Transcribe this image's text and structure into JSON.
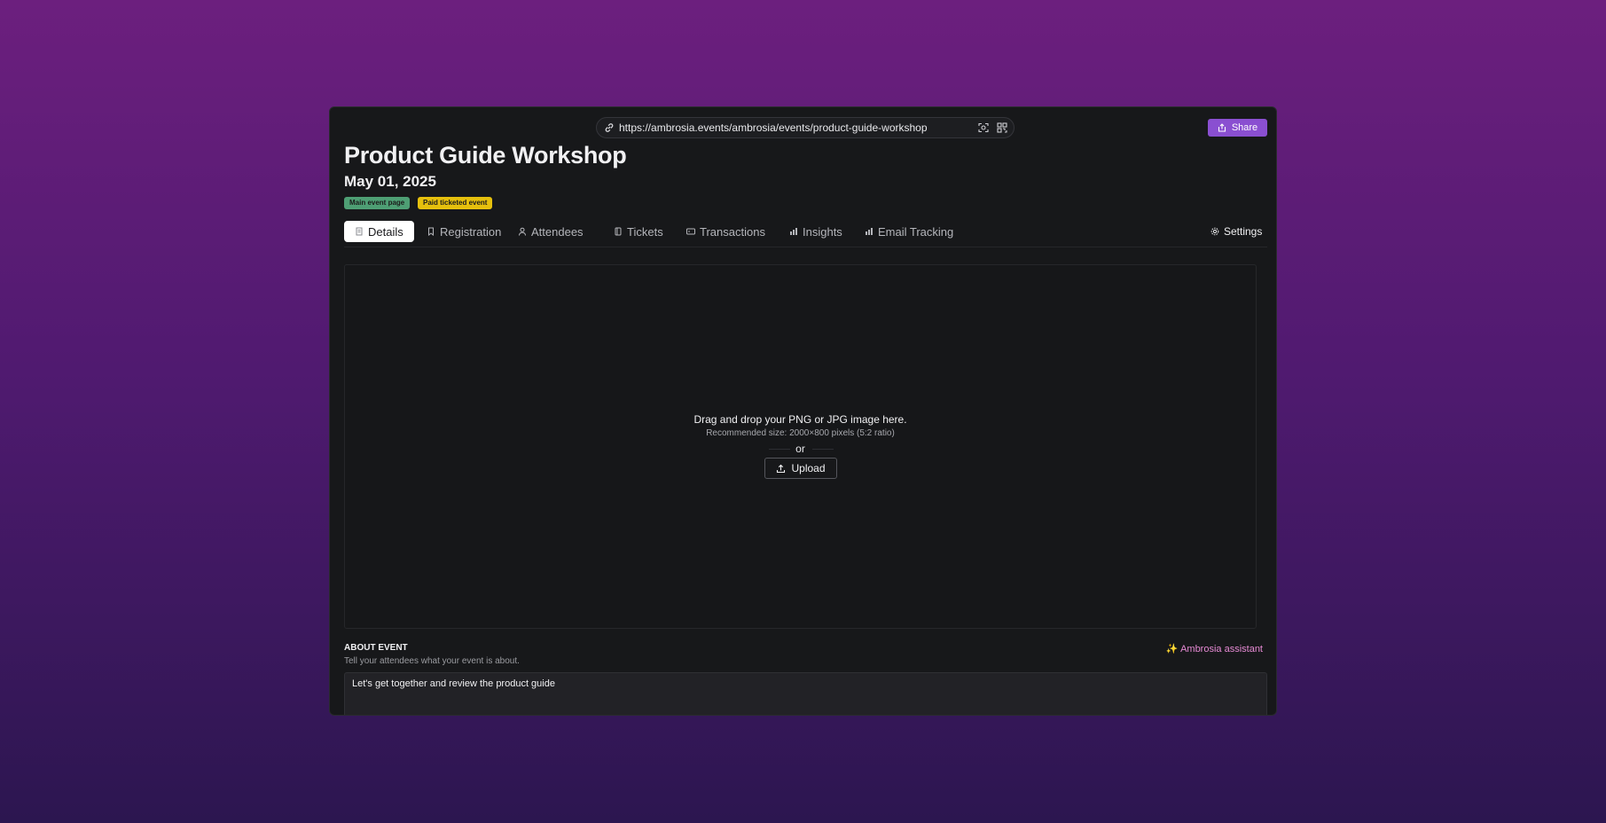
{
  "browser": {
    "url": "https://ambrosia.events/ambrosia/events/product-guide-workshop",
    "share_label": "Share"
  },
  "event": {
    "title": "Product Guide Workshop",
    "date": "May 01, 2025",
    "badges": [
      "Main event page",
      "Paid ticketed event"
    ]
  },
  "tabs": [
    {
      "label": "Details",
      "icon": "document-icon",
      "active": true
    },
    {
      "label": "Registration",
      "icon": "bookmark-icon"
    },
    {
      "label": "Attendees",
      "icon": "person-icon"
    },
    {
      "label": "Tickets",
      "icon": "ticket-icon"
    },
    {
      "label": "Transactions",
      "icon": "card-icon"
    },
    {
      "label": "Insights",
      "icon": "bar-chart-icon"
    },
    {
      "label": "Email Tracking",
      "icon": "bar-chart-icon"
    }
  ],
  "settings_label": "Settings",
  "dropzone": {
    "main_text": "Drag and drop your PNG or JPG image here.",
    "sub_text": "Recommended size: 2000×800 pixels (5:2 ratio)",
    "or_text": "or",
    "upload_label": "Upload"
  },
  "about": {
    "label": "ABOUT EVENT",
    "subtitle": "Tell your attendees what your event is about.",
    "assistant_label": "✨ Ambrosia assistant",
    "value": "Let's get together and review the product guide"
  },
  "colors": {
    "accent": "#8a4fd1",
    "badge_green": "#4e9f74",
    "badge_yellow": "#e6c00d",
    "assistant_pink": "#e68ad4"
  }
}
